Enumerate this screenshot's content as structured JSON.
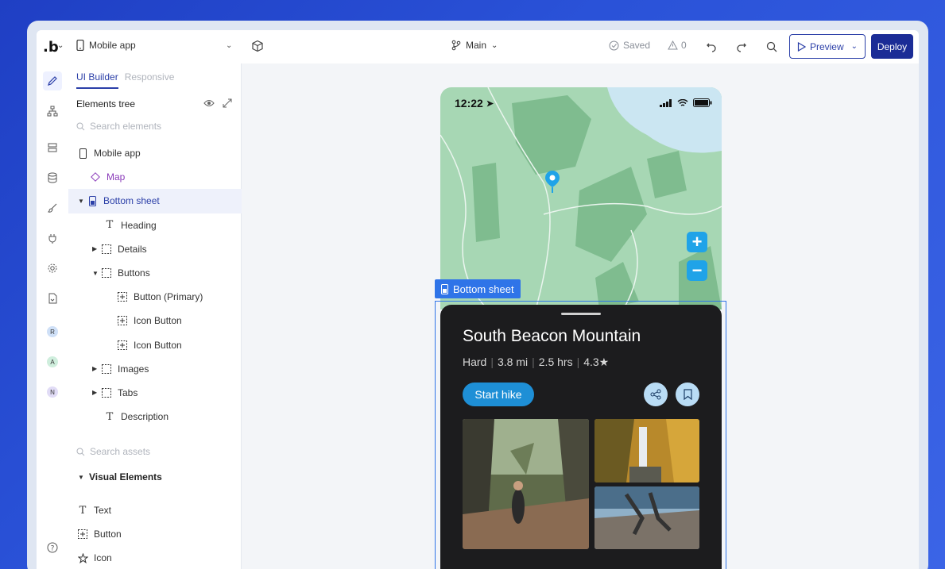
{
  "topbar": {
    "logo": ".b",
    "project": "Mobile app",
    "branch": "Main",
    "saved": "Saved",
    "warnings": "0",
    "preview": "Preview",
    "deploy": "Deploy"
  },
  "panel": {
    "tabs": [
      "UI Builder",
      "Responsive"
    ],
    "tree_heading": "Elements tree",
    "search_placeholder": "Search elements",
    "tree": [
      {
        "label": "Mobile app",
        "icon": "phone-icon",
        "indent": 0
      },
      {
        "label": "Map",
        "icon": "diamond-icon",
        "indent": 1
      },
      {
        "label": "Bottom sheet",
        "icon": "sheet-icon",
        "indent": 1
      },
      {
        "label": "Heading",
        "icon": "text-icon",
        "indent": 2
      },
      {
        "label": "Details",
        "icon": "frame-icon",
        "indent": 2
      },
      {
        "label": "Buttons",
        "icon": "frame-icon",
        "indent": 2
      },
      {
        "label": "Button (Primary)",
        "icon": "button-icon",
        "indent": 3
      },
      {
        "label": "Icon Button",
        "icon": "button-icon",
        "indent": 3
      },
      {
        "label": "Icon Button",
        "icon": "button-icon",
        "indent": 3
      },
      {
        "label": "Images",
        "icon": "frame-icon",
        "indent": 2
      },
      {
        "label": "Tabs",
        "icon": "frame-icon",
        "indent": 2
      },
      {
        "label": "Description",
        "icon": "text-icon",
        "indent": 2
      }
    ],
    "assets_search_placeholder": "Search assets",
    "assets_group": "Visual Elements",
    "assets": [
      {
        "label": "Text",
        "icon": "text-icon"
      },
      {
        "label": "Button",
        "icon": "button-icon"
      },
      {
        "label": "Icon",
        "icon": "star-icon"
      }
    ]
  },
  "rail": {
    "badges": [
      "R",
      "A",
      "N"
    ]
  },
  "canvas": {
    "time": "12:22",
    "sheet_label": "Bottom sheet",
    "title": "South Beacon Mountain",
    "difficulty": "Hard",
    "distance": "3.8 mi",
    "duration": "2.5 hrs",
    "rating": "4.3★",
    "start_button": "Start hike"
  },
  "colors": {
    "accent": "#2b3fa8",
    "map_green": "#a7d7b4",
    "sheet_bg": "#1c1c1e",
    "start_button": "#1e8fd6",
    "selection": "#2f74e8"
  }
}
